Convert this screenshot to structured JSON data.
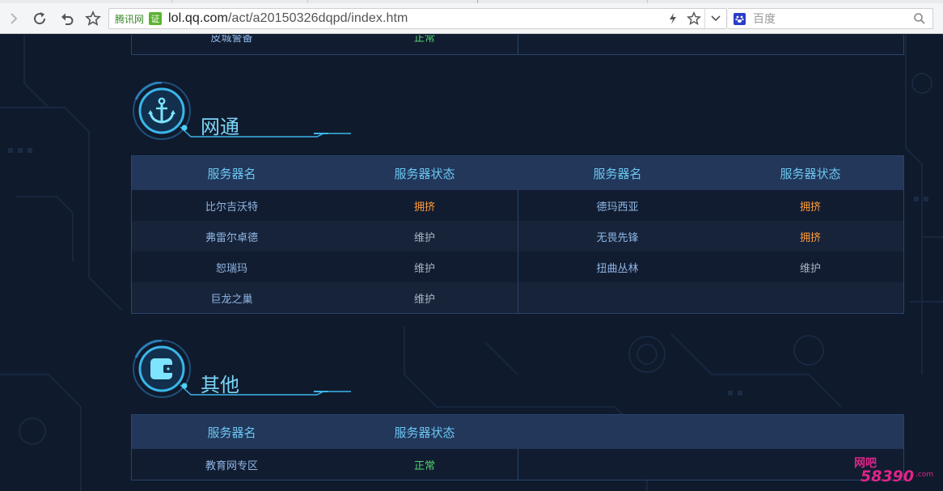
{
  "browser": {
    "site_name": "腾讯网",
    "cert_badge": "证",
    "url_host": "lol.qq.com",
    "url_path": "/act/a20150326dqpd/index.htm",
    "search_placeholder": "百度"
  },
  "top_table": {
    "partial_row": {
      "name": "皮城警备",
      "status": "正常",
      "status_type": "normal"
    }
  },
  "sections": [
    {
      "title": "网通",
      "icon": "anchor-icon",
      "headers": [
        "服务器名",
        "服务器状态",
        "服务器名",
        "服务器状态"
      ],
      "rows": [
        {
          "left": {
            "name": "比尔吉沃特",
            "status": "拥挤"
          },
          "right": {
            "name": "德玛西亚",
            "status": "拥挤"
          }
        },
        {
          "left": {
            "name": "弗雷尔卓德",
            "status": "维护"
          },
          "right": {
            "name": "无畏先锋",
            "status": "拥挤"
          }
        },
        {
          "left": {
            "name": "恕瑞玛",
            "status": "维护"
          },
          "right": {
            "name": "扭曲丛林",
            "status": "维护"
          }
        },
        {
          "left": {
            "name": "巨龙之巢",
            "status": "维护"
          },
          "right": {
            "name": "",
            "status": ""
          }
        }
      ]
    },
    {
      "title": "其他",
      "icon": "wallet-icon",
      "headers": [
        "服务器名",
        "服务器状态",
        "",
        ""
      ],
      "rows": [
        {
          "left": {
            "name": "教育网专区",
            "status": "正常"
          },
          "right": {
            "name": "",
            "status": ""
          }
        }
      ]
    }
  ],
  "status_colors": {
    "正常": "#4fd26f",
    "拥挤": "#ff9c3a",
    "维护": "#a9b4c4"
  },
  "watermark": {
    "brand": "网吧",
    "number": "58390",
    "domain": ".com"
  }
}
